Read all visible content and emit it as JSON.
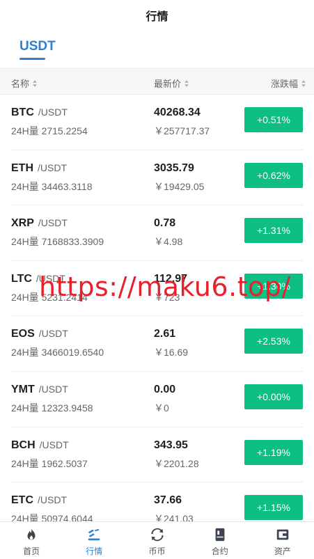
{
  "header": {
    "title": "行情"
  },
  "tabs": {
    "active": "USDT"
  },
  "columns": {
    "name": "名称",
    "price": "最新价",
    "change": "涨跌幅"
  },
  "rows": [
    {
      "symbol": "BTC",
      "quote": "/USDT",
      "volume": "24H量 2715.2254",
      "price": "40268.34",
      "cny": "￥257717.37",
      "change": "+0.51%"
    },
    {
      "symbol": "ETH",
      "quote": "/USDT",
      "volume": "24H量 34463.3118",
      "price": "3035.79",
      "cny": "￥19429.05",
      "change": "+0.62%"
    },
    {
      "symbol": "XRP",
      "quote": "/USDT",
      "volume": "24H量 7168833.3909",
      "price": "0.78",
      "cny": "￥4.98",
      "change": "+1.31%"
    },
    {
      "symbol": "LTC",
      "quote": "/USDT",
      "volume": "24H量 5231.2414",
      "price": "112.97",
      "cny": "￥723",
      "change": "+1.30%"
    },
    {
      "symbol": "EOS",
      "quote": "/USDT",
      "volume": "24H量 3466019.6540",
      "price": "2.61",
      "cny": "￥16.69",
      "change": "+2.53%"
    },
    {
      "symbol": "YMT",
      "quote": "/USDT",
      "volume": "24H量 12323.9458",
      "price": "0.00",
      "cny": "￥0",
      "change": "+0.00%"
    },
    {
      "symbol": "BCH",
      "quote": "/USDT",
      "volume": "24H量 1962.5037",
      "price": "343.95",
      "cny": "￥2201.28",
      "change": "+1.19%"
    },
    {
      "symbol": "ETC",
      "quote": "/USDT",
      "volume": "24H量 50974.6044",
      "price": "37.66",
      "cny": "￥241.03",
      "change": "+1.15%"
    }
  ],
  "watermark": "https://maku6.top/",
  "tabbar": [
    {
      "label": "首页",
      "icon": "fire-icon"
    },
    {
      "label": "行情",
      "icon": "market-icon",
      "active": true
    },
    {
      "label": "币币",
      "icon": "exchange-icon"
    },
    {
      "label": "合约",
      "icon": "contract-icon"
    },
    {
      "label": "资产",
      "icon": "wallet-icon"
    }
  ],
  "colors": {
    "accent": "#2f7fd0",
    "up": "#0dbe85",
    "watermark": "#e8202a",
    "icon": "#3d4452"
  }
}
